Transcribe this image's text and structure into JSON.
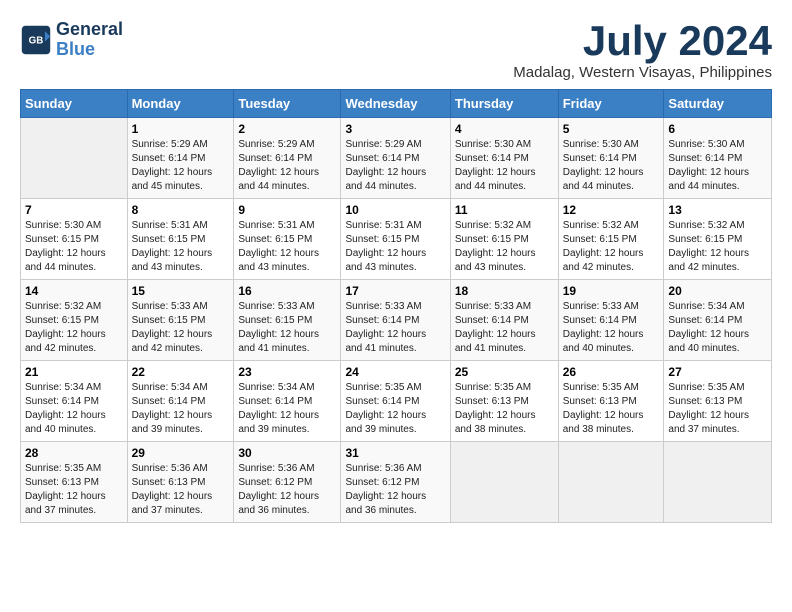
{
  "logo": {
    "line1": "General",
    "line2": "Blue"
  },
  "title": "July 2024",
  "subtitle": "Madalag, Western Visayas, Philippines",
  "days_header": [
    "Sunday",
    "Monday",
    "Tuesday",
    "Wednesday",
    "Thursday",
    "Friday",
    "Saturday"
  ],
  "weeks": [
    [
      {
        "num": "",
        "info": ""
      },
      {
        "num": "1",
        "info": "Sunrise: 5:29 AM\nSunset: 6:14 PM\nDaylight: 12 hours\nand 45 minutes."
      },
      {
        "num": "2",
        "info": "Sunrise: 5:29 AM\nSunset: 6:14 PM\nDaylight: 12 hours\nand 44 minutes."
      },
      {
        "num": "3",
        "info": "Sunrise: 5:29 AM\nSunset: 6:14 PM\nDaylight: 12 hours\nand 44 minutes."
      },
      {
        "num": "4",
        "info": "Sunrise: 5:30 AM\nSunset: 6:14 PM\nDaylight: 12 hours\nand 44 minutes."
      },
      {
        "num": "5",
        "info": "Sunrise: 5:30 AM\nSunset: 6:14 PM\nDaylight: 12 hours\nand 44 minutes."
      },
      {
        "num": "6",
        "info": "Sunrise: 5:30 AM\nSunset: 6:14 PM\nDaylight: 12 hours\nand 44 minutes."
      }
    ],
    [
      {
        "num": "7",
        "info": "Sunrise: 5:30 AM\nSunset: 6:15 PM\nDaylight: 12 hours\nand 44 minutes."
      },
      {
        "num": "8",
        "info": "Sunrise: 5:31 AM\nSunset: 6:15 PM\nDaylight: 12 hours\nand 43 minutes."
      },
      {
        "num": "9",
        "info": "Sunrise: 5:31 AM\nSunset: 6:15 PM\nDaylight: 12 hours\nand 43 minutes."
      },
      {
        "num": "10",
        "info": "Sunrise: 5:31 AM\nSunset: 6:15 PM\nDaylight: 12 hours\nand 43 minutes."
      },
      {
        "num": "11",
        "info": "Sunrise: 5:32 AM\nSunset: 6:15 PM\nDaylight: 12 hours\nand 43 minutes."
      },
      {
        "num": "12",
        "info": "Sunrise: 5:32 AM\nSunset: 6:15 PM\nDaylight: 12 hours\nand 42 minutes."
      },
      {
        "num": "13",
        "info": "Sunrise: 5:32 AM\nSunset: 6:15 PM\nDaylight: 12 hours\nand 42 minutes."
      }
    ],
    [
      {
        "num": "14",
        "info": "Sunrise: 5:32 AM\nSunset: 6:15 PM\nDaylight: 12 hours\nand 42 minutes."
      },
      {
        "num": "15",
        "info": "Sunrise: 5:33 AM\nSunset: 6:15 PM\nDaylight: 12 hours\nand 42 minutes."
      },
      {
        "num": "16",
        "info": "Sunrise: 5:33 AM\nSunset: 6:15 PM\nDaylight: 12 hours\nand 41 minutes."
      },
      {
        "num": "17",
        "info": "Sunrise: 5:33 AM\nSunset: 6:14 PM\nDaylight: 12 hours\nand 41 minutes."
      },
      {
        "num": "18",
        "info": "Sunrise: 5:33 AM\nSunset: 6:14 PM\nDaylight: 12 hours\nand 41 minutes."
      },
      {
        "num": "19",
        "info": "Sunrise: 5:33 AM\nSunset: 6:14 PM\nDaylight: 12 hours\nand 40 minutes."
      },
      {
        "num": "20",
        "info": "Sunrise: 5:34 AM\nSunset: 6:14 PM\nDaylight: 12 hours\nand 40 minutes."
      }
    ],
    [
      {
        "num": "21",
        "info": "Sunrise: 5:34 AM\nSunset: 6:14 PM\nDaylight: 12 hours\nand 40 minutes."
      },
      {
        "num": "22",
        "info": "Sunrise: 5:34 AM\nSunset: 6:14 PM\nDaylight: 12 hours\nand 39 minutes."
      },
      {
        "num": "23",
        "info": "Sunrise: 5:34 AM\nSunset: 6:14 PM\nDaylight: 12 hours\nand 39 minutes."
      },
      {
        "num": "24",
        "info": "Sunrise: 5:35 AM\nSunset: 6:14 PM\nDaylight: 12 hours\nand 39 minutes."
      },
      {
        "num": "25",
        "info": "Sunrise: 5:35 AM\nSunset: 6:13 PM\nDaylight: 12 hours\nand 38 minutes."
      },
      {
        "num": "26",
        "info": "Sunrise: 5:35 AM\nSunset: 6:13 PM\nDaylight: 12 hours\nand 38 minutes."
      },
      {
        "num": "27",
        "info": "Sunrise: 5:35 AM\nSunset: 6:13 PM\nDaylight: 12 hours\nand 37 minutes."
      }
    ],
    [
      {
        "num": "28",
        "info": "Sunrise: 5:35 AM\nSunset: 6:13 PM\nDaylight: 12 hours\nand 37 minutes."
      },
      {
        "num": "29",
        "info": "Sunrise: 5:36 AM\nSunset: 6:13 PM\nDaylight: 12 hours\nand 37 minutes."
      },
      {
        "num": "30",
        "info": "Sunrise: 5:36 AM\nSunset: 6:12 PM\nDaylight: 12 hours\nand 36 minutes."
      },
      {
        "num": "31",
        "info": "Sunrise: 5:36 AM\nSunset: 6:12 PM\nDaylight: 12 hours\nand 36 minutes."
      },
      {
        "num": "",
        "info": ""
      },
      {
        "num": "",
        "info": ""
      },
      {
        "num": "",
        "info": ""
      }
    ]
  ]
}
